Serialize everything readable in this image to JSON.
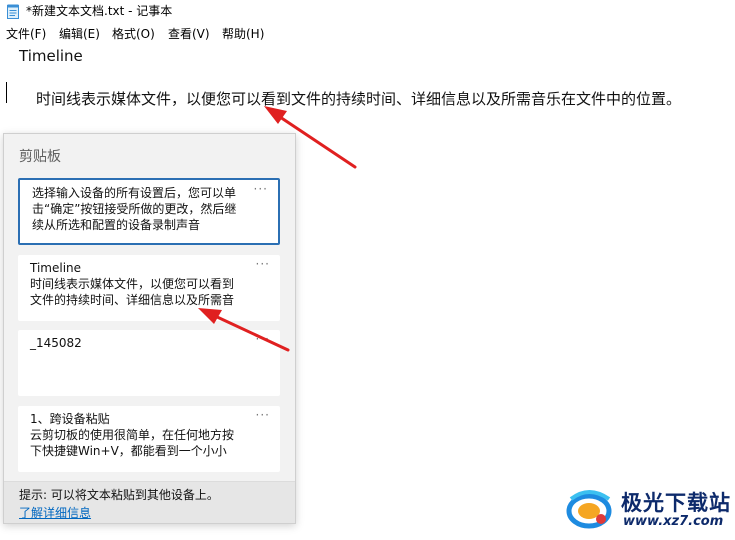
{
  "window": {
    "title": "*新建文本文档.txt - 记事本"
  },
  "menu": {
    "items": [
      "文件(F)",
      "编辑(E)",
      "格式(O)",
      "查看(V)",
      "帮助(H)"
    ]
  },
  "document": {
    "line1": "Timeline",
    "line2": "时间线表示媒体文件，以便您可以看到文件的持续时间、详细信息以及所需音乐在文件中的位置。"
  },
  "clipboard": {
    "title": "剪贴板",
    "more_label": "···",
    "items": [
      {
        "text": "选择输入设备的所有设置后，您可以单\n击“确定”按钮接受所做的更改，然后继\n续从所选和配置的设备录制声音",
        "selected": true
      },
      {
        "text": "Timeline\n时间线表示媒体文件，以便您可以看到\n文件的持续时间、详细信息以及所需音",
        "selected": false
      },
      {
        "text": "_145082",
        "selected": false
      },
      {
        "text": "1、跨设备粘贴\n云剪切板的使用很简单，在任何地方按\n下快捷键Win+V，都能看到一个小小",
        "selected": false
      }
    ],
    "footer_hint": "提示: 可以将文本粘贴到其他设备上。",
    "learn_more": "了解详细信息"
  },
  "watermark": {
    "name": "极光下载站",
    "url": "www.xz7.com",
    "logo_icon": "aurora-logo-icon"
  },
  "colors": {
    "accent_border": "#2b6fb3",
    "link": "#0067c0",
    "annotation_arrow": "#e02020",
    "watermark_text": "#0d2a6b"
  }
}
